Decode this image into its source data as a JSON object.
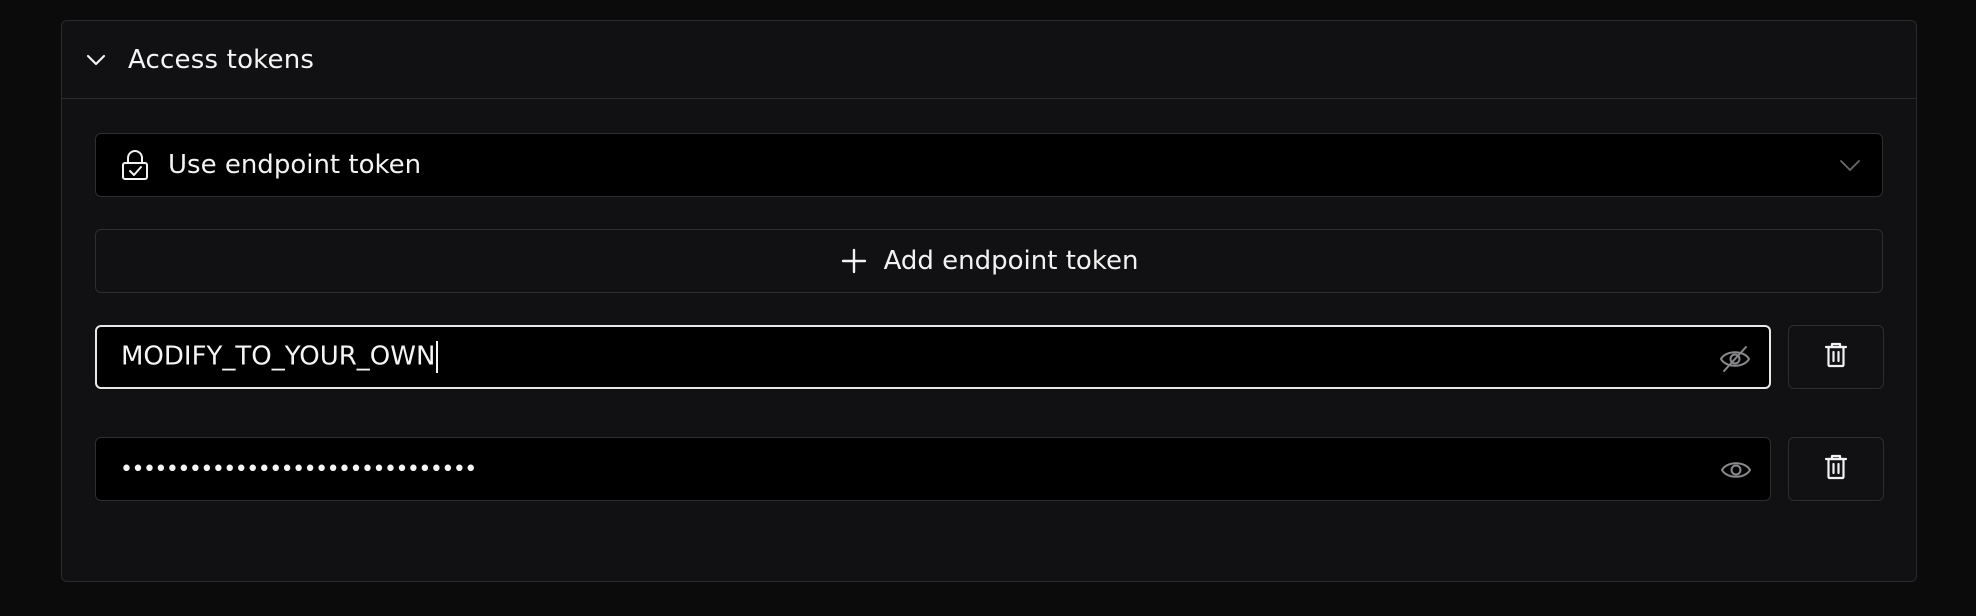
{
  "section": {
    "title": "Access tokens",
    "expanded_icon": "chevron-down-icon"
  },
  "token_select": {
    "selected": "Use endpoint token",
    "icon": "lock-check-icon",
    "caret_icon": "chevron-down-icon"
  },
  "add_button": {
    "label": "Add endpoint token",
    "icon": "plus-icon"
  },
  "tokens": [
    {
      "value": "MODIFY_TO_YOUR_OWN",
      "visible": true,
      "toggle_icon": "eye-off-icon",
      "delete_icon": "trash-icon"
    },
    {
      "value": "•••••••••••••••••••••••••••••••",
      "visible": false,
      "toggle_icon": "eye-icon",
      "delete_icon": "trash-icon"
    }
  ],
  "colors": {
    "page_bg": "#0b0b0c",
    "panel_bg": "#111113",
    "input_bg": "#000000",
    "border": "#2e2e31",
    "focus_border": "#e8e8e8",
    "text": "#f2f2f2",
    "icon_muted": "#8a8a8e"
  }
}
